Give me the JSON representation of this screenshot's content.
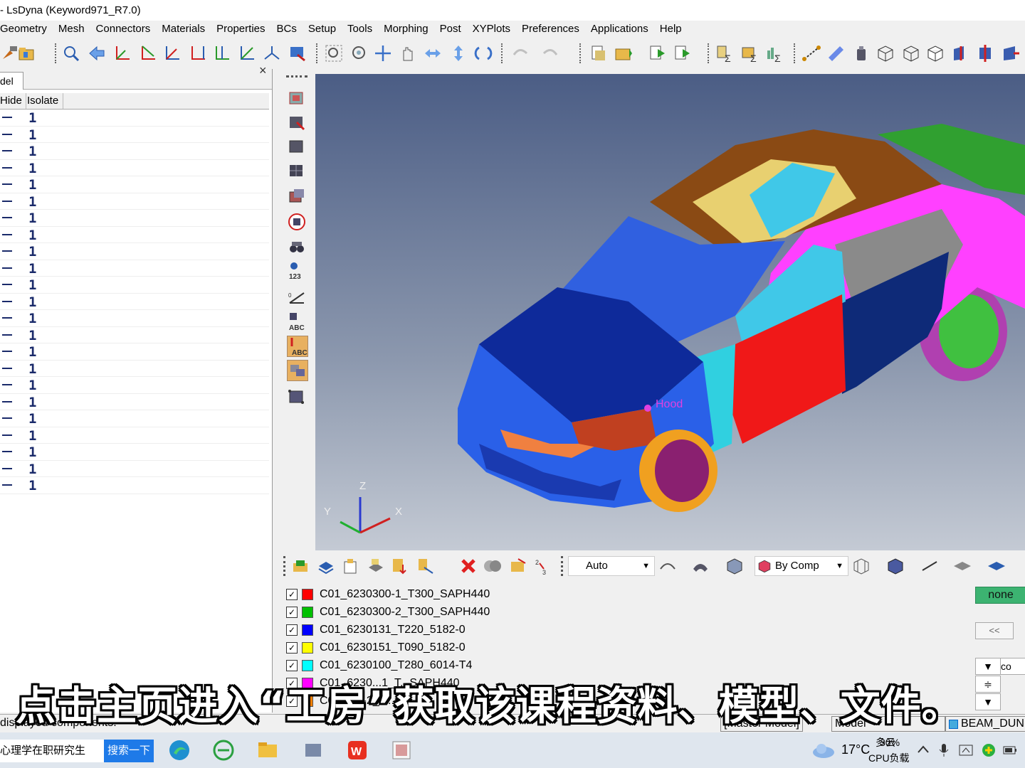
{
  "window": {
    "title": "- LsDyna (Keyword971_R7.0)"
  },
  "menu": [
    "Geometry",
    "Mesh",
    "Connectors",
    "Materials",
    "Properties",
    "BCs",
    "Setup",
    "Tools",
    "Morphing",
    "Post",
    "XYPlots",
    "Preferences",
    "Applications",
    "Help"
  ],
  "left_panel": {
    "tab_label": "del",
    "close_symbol": "×",
    "columns": [
      "Hide",
      "Isolate"
    ],
    "row_value": "1",
    "row_count": 23
  },
  "viewport": {
    "label": "Hood",
    "axes": {
      "z": "Z",
      "y": "Y",
      "x": "X"
    }
  },
  "bottom_toolbar": {
    "auto_label": "Auto",
    "color_by_label": "By Comp"
  },
  "components": [
    {
      "name": "C01_6230300-1_T300_SAPH440",
      "color": "#ff0000"
    },
    {
      "name": "C01_6230300-2_T300_SAPH440",
      "color": "#00c000"
    },
    {
      "name": "C01_6230131_T220_5182-0",
      "color": "#0000ff"
    },
    {
      "name": "C01_6230151_T090_5182-0",
      "color": "#ffff00"
    },
    {
      "name": "C01_6230100_T280_6014-T4",
      "color": "#00ffff"
    },
    {
      "name": "C01_6230...1_T...SAPH440",
      "color": "#ff00ff"
    },
    {
      "name": "C01...00-2_T...",
      "color": "#ff8000"
    }
  ],
  "side_buttons": {
    "none": "none",
    "back": "<<",
    "down": "▼",
    "updown": "≑",
    "down2": "▼",
    "co": "co"
  },
  "status": {
    "text": "displayed components.",
    "master_model": "[Master Model]",
    "model": "Model",
    "beam": "BEAM_DUN"
  },
  "caption": "点击主页进入“工房”获取该课程资料、模型、文件。",
  "taskbar": {
    "search_hint": "心理学在职研究生",
    "search_button": "搜索一下",
    "weather": "17°C",
    "weather_desc": "多云",
    "cpu_percent": "30%",
    "cpu_label": "CPU负载"
  }
}
